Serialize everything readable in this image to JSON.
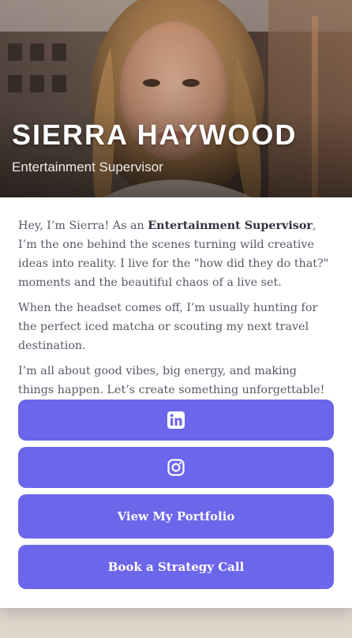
{
  "profile": {
    "name": "SIERRA HAYWOOD",
    "title": "Entertainment Supervisor"
  },
  "bio": {
    "p1_intro": "Hey, I’m Sierra! As an ",
    "p1_role": "Entertainment Supervisor",
    "p1_rest": ", I’m the one behind the scenes turning wild creative ideas into reality. I live for the \"how did they do that?\" moments and the beautiful chaos of a live set.",
    "p2": "When the headset comes off, I’m usually hunting for the perfect iced matcha or scouting my next travel destination.",
    "p3": "I’m all about good vibes, big energy, and making things happen. Let’s create something unforgettable!"
  },
  "buttons": {
    "linkedin_icon": "linkedin-icon",
    "instagram_icon": "instagram-icon",
    "portfolio_label": "View My Portfolio",
    "call_label": "Book a Strategy Call"
  },
  "colors": {
    "accent": "#6c66ea",
    "page_background": "#ddd6cb"
  }
}
